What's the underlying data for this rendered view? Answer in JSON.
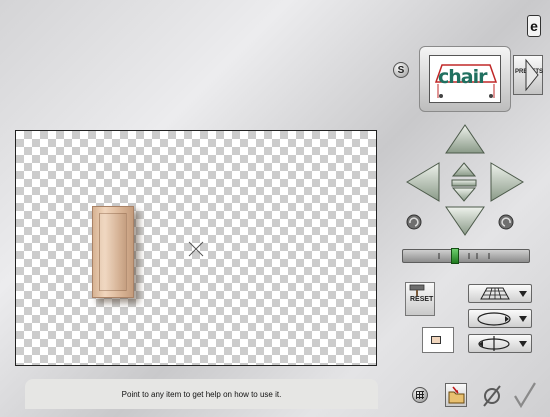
{
  "header": {
    "help_icon_glyph": "e",
    "s_label": "S",
    "thumbnail_word": "chair",
    "presets_label": "PRESETS"
  },
  "canvas": {
    "background": "checkerboard",
    "object_color": "#e8c8a8"
  },
  "navigation": {
    "up": "arrow-up-icon",
    "down": "arrow-down-icon",
    "left": "arrow-left-icon",
    "right": "arrow-right-icon",
    "center": "center-arrows-icon",
    "rotate_left": "rotate-left-icon",
    "rotate_right": "rotate-right-icon"
  },
  "slider": {
    "position": 0.42,
    "accent": "#2a9a2a"
  },
  "controls": {
    "reset_label": "RESET",
    "dropdowns": [
      "plane-grid-icon",
      "ellipse-icon",
      "rotate-axis-icon"
    ]
  },
  "status": {
    "help_text": "Point to any item to get help on how to use it."
  },
  "footer": {
    "grid": "grid-icon",
    "folder": "folder-icon",
    "cancel": "cancel-icon",
    "ok": "checkmark-icon"
  }
}
